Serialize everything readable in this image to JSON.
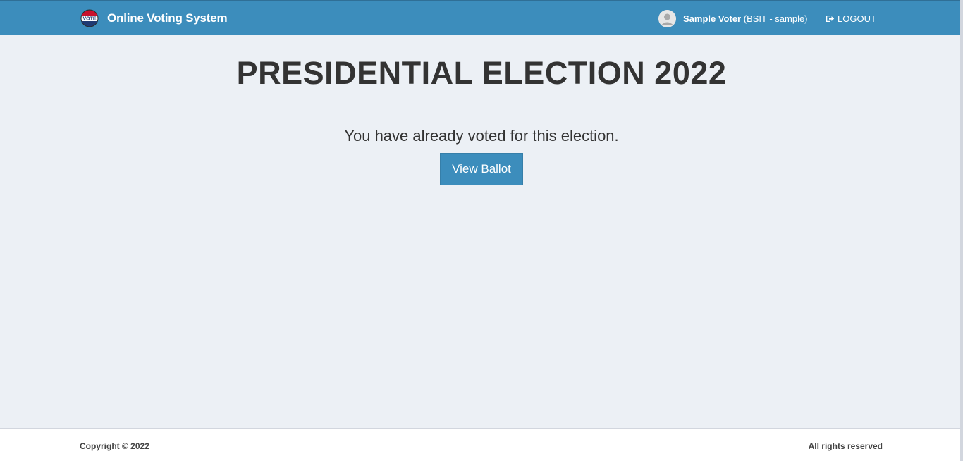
{
  "header": {
    "brand_title": "Online Voting System",
    "logo_text": "VOTE",
    "user_name": "Sample Voter",
    "user_detail": " (BSIT - sample)",
    "logout_label": "LOGOUT"
  },
  "main": {
    "election_title": "PRESIDENTIAL ELECTION 2022",
    "voted_message": "You have already voted for this election.",
    "view_ballot_label": "View Ballot"
  },
  "footer": {
    "copyright": "Copyright © 2022",
    "rights": "All rights reserved"
  },
  "colors": {
    "header_bg": "#3c8dbc",
    "content_bg": "#ecf0f5",
    "button_bg": "#3c8dbc",
    "footer_bg": "#ffffff"
  },
  "icons": [
    "vote-badge-icon",
    "user-avatar-icon",
    "sign-out-icon"
  ]
}
